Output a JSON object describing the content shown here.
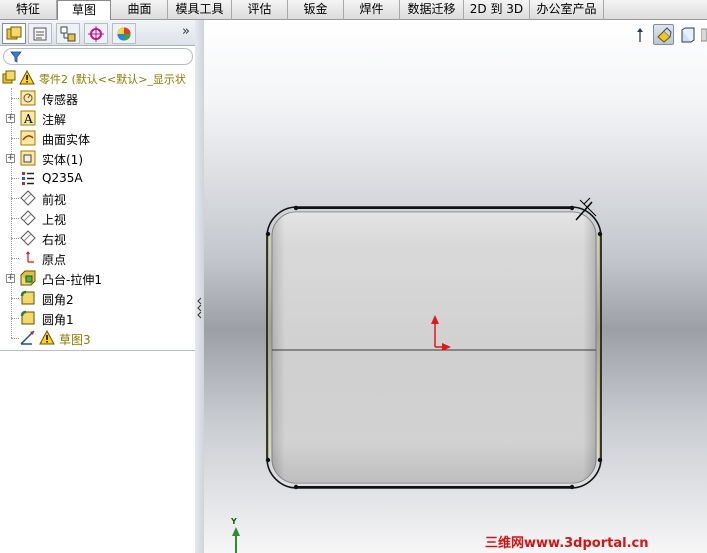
{
  "tabs": [
    {
      "label": "特征",
      "active": false
    },
    {
      "label": "草图",
      "active": true
    },
    {
      "label": "曲面",
      "active": false
    },
    {
      "label": "模具工具",
      "active": false
    },
    {
      "label": "评估",
      "active": false
    },
    {
      "label": "钣金",
      "active": false
    },
    {
      "label": "焊件",
      "active": false
    },
    {
      "label": "数据迁移",
      "active": false
    },
    {
      "label": "2D 到 3D",
      "active": false
    },
    {
      "label": "办公室产品",
      "active": false
    }
  ],
  "panel_tabs": [
    {
      "icon": "feature-manager-icon",
      "active": true
    },
    {
      "icon": "property-manager-icon",
      "active": false
    },
    {
      "icon": "configuration-manager-icon",
      "active": false
    },
    {
      "icon": "dimxpert-manager-icon",
      "active": false
    },
    {
      "icon": "display-manager-icon",
      "active": false
    }
  ],
  "panel_expand_glyph": "»",
  "tree": {
    "root_label": "零件2  (默认<<默认>_显示状",
    "items": [
      {
        "label": "传感器",
        "icon": "sensor-icon",
        "expandable": false
      },
      {
        "label": "注解",
        "icon": "annotation-icon",
        "expandable": true
      },
      {
        "label": "曲面实体",
        "icon": "surface-bodies-icon",
        "expandable": false
      },
      {
        "label": "实体(1)",
        "icon": "solid-bodies-icon",
        "expandable": true
      },
      {
        "label": "Q235A",
        "icon": "material-icon",
        "expandable": false
      },
      {
        "label": "前视",
        "icon": "plane-icon",
        "expandable": false
      },
      {
        "label": "上视",
        "icon": "plane-icon",
        "expandable": false
      },
      {
        "label": "右视",
        "icon": "plane-icon",
        "expandable": false
      },
      {
        "label": "原点",
        "icon": "origin-icon",
        "expandable": false
      },
      {
        "label": "凸台-拉伸1",
        "icon": "extrude-icon",
        "expandable": true
      },
      {
        "label": "圆角2",
        "icon": "fillet-icon",
        "expandable": false
      },
      {
        "label": "圆角1",
        "icon": "fillet-icon",
        "expandable": false
      },
      {
        "label": "草图3",
        "icon": "sketch-icon",
        "expandable": false,
        "warning": true
      }
    ]
  },
  "axis_label": "Y",
  "watermark": "三维网www.3dportal.cn",
  "colors": {
    "warning_text": "#8a7a00",
    "origin_red": "#e01818",
    "axis_green": "#2e8b2e",
    "watermark_red": "#d41414"
  }
}
